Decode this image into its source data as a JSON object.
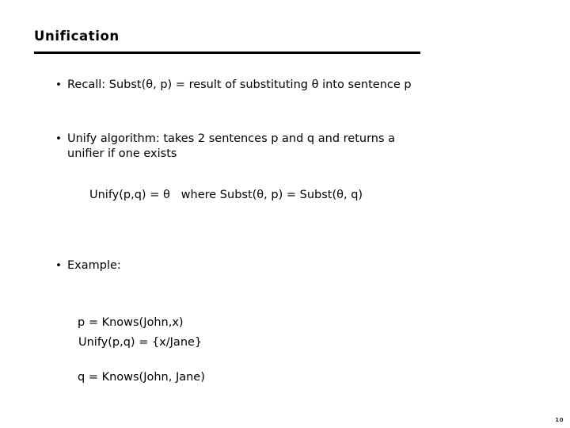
{
  "slide": {
    "title": "Unification",
    "page_number": "10",
    "bullet_glyph": "•",
    "blocks": [
      {
        "id": "recall",
        "text": "Recall: Subst(θ, p) = result of substituting θ into sentence p"
      },
      {
        "id": "unify-algorithm",
        "line1": "Unify algorithm: takes 2 sentences p and q and returns a",
        "line2": "unifier if one exists"
      },
      {
        "id": "example",
        "text": "Example:"
      }
    ],
    "formulas": {
      "unify_definition": "Unify(p,q) = θ   where Subst(θ, p) = Subst(θ, q)",
      "example_result": "Unify(p,q) = {x/Jane}"
    },
    "example_lines": {
      "p": "p = Knows(John,x)",
      "q": "q = Knows(John, Jane)"
    }
  }
}
